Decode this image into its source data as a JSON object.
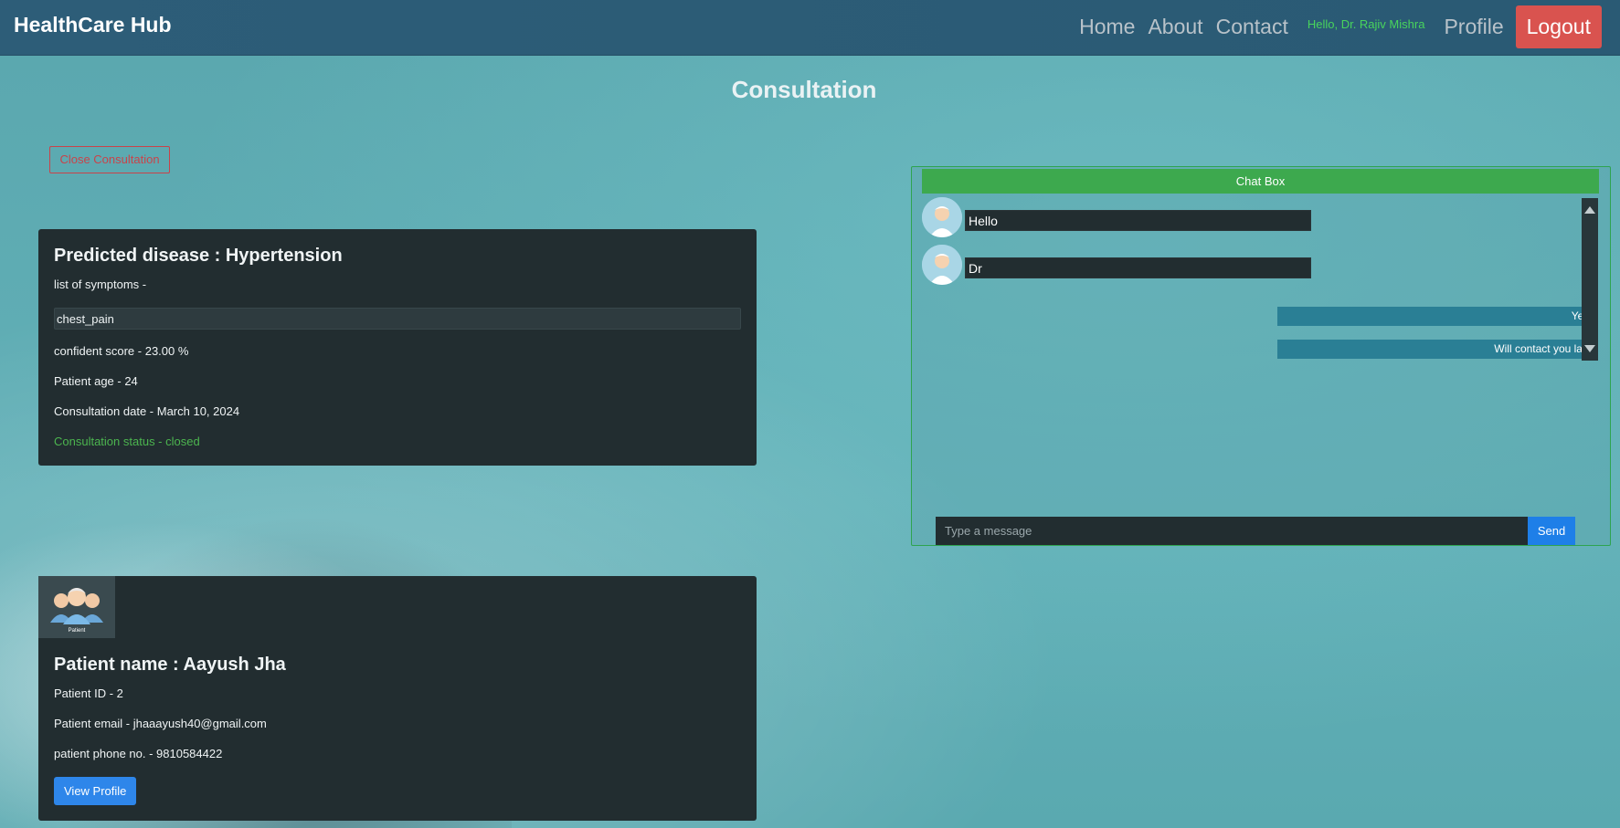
{
  "navbar": {
    "brand": "HealthCare Hub",
    "links": [
      "Home",
      "About",
      "Contact"
    ],
    "greeting": "Hello, Dr. Rajiv Mishra",
    "profile": "Profile",
    "logout": "Logout"
  },
  "page": {
    "title": "Consultation",
    "close_button": "Close Consultation"
  },
  "disease_card": {
    "title": "Predicted disease : Hypertension",
    "symptoms_label": "list of symptoms -",
    "symptoms": [
      "chest_pain"
    ],
    "confidence": "confident score - 23.00 %",
    "age": "Patient age - 24",
    "date": "Consultation date - March 10, 2024",
    "status": "Consultation status - closed"
  },
  "patient_card": {
    "image_label": "Patient",
    "name": "Patient name : Aayush Jha",
    "id": "Patient ID - 2",
    "email": "Patient email - jhaaayush40@gmail.com",
    "phone": "patient phone no. - 9810584422",
    "view_profile": "View Profile"
  },
  "chat": {
    "header": "Chat Box",
    "messages": [
      {
        "direction": "received",
        "text": "Hello"
      },
      {
        "direction": "received",
        "text": "Dr"
      },
      {
        "direction": "sent",
        "text": "Yes !"
      },
      {
        "direction": "sent",
        "text": "Will contact you later"
      }
    ],
    "input_placeholder": "Type a message",
    "send": "Send"
  },
  "colors": {
    "navbar": "#2d5d78",
    "accent_green": "#3da94e",
    "danger": "#d9534f",
    "primary": "#2e86ea",
    "card": "#222d30"
  }
}
